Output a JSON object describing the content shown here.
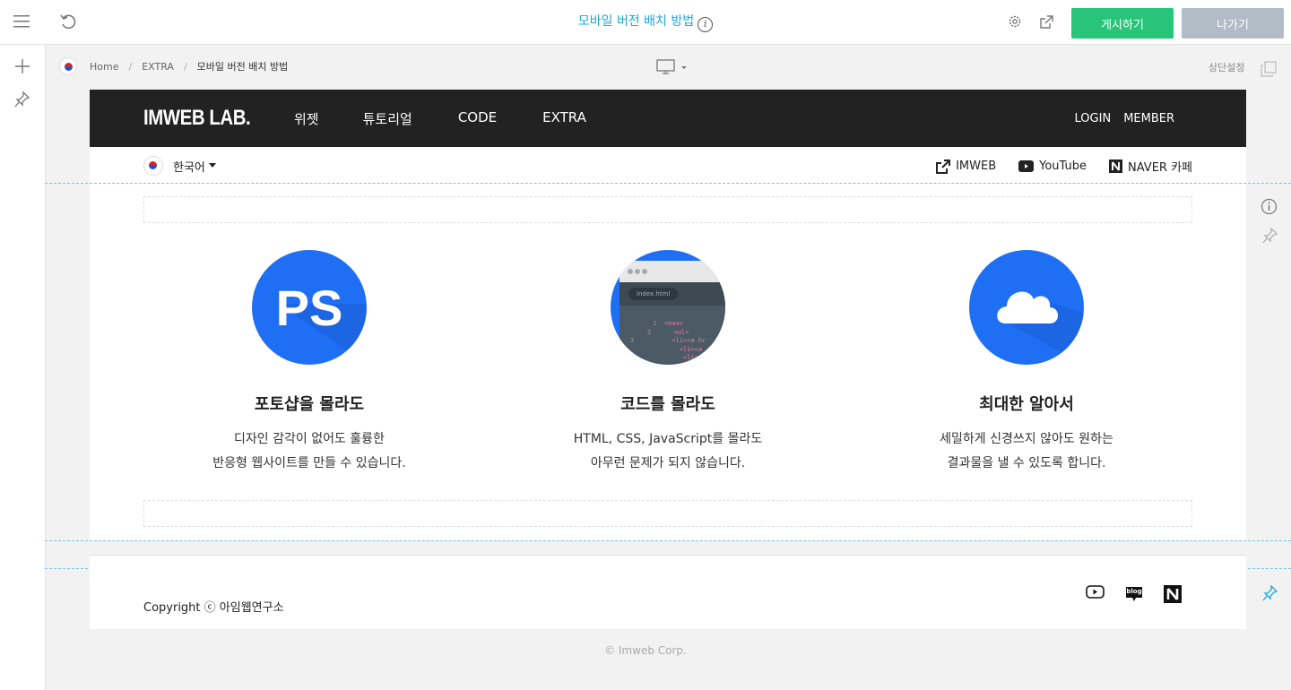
{
  "toolbar": {
    "page_title": "모바일 버전 배치 방법",
    "info_glyph": "i",
    "publish_label": "게시하기",
    "exit_label": "나가기"
  },
  "breadcrumb": {
    "items": [
      "Home",
      "EXTRA",
      "모바일 버전 배치 방법"
    ],
    "separator": "/"
  },
  "editor": {
    "top_setting_label": "상단설정"
  },
  "site": {
    "logo": "IMWEB LAB.",
    "nav": [
      "위젯",
      "튜토리얼",
      "CODE",
      "EXTRA"
    ],
    "login": "LOGIN",
    "member": "MEMBER",
    "language": "한국어",
    "links": [
      {
        "icon": "external-link-icon",
        "label": "IMWEB"
      },
      {
        "icon": "youtube-icon",
        "label": "YouTube"
      },
      {
        "icon": "naver-icon",
        "label": "NAVER 카페"
      }
    ]
  },
  "features": [
    {
      "icon": "photoshop-icon",
      "icon_text": "PS",
      "title": "포토샵을 몰라도",
      "line1": "디자인 감각이 없어도 훌륭한",
      "line2": "반응형 웹사이트를 만들 수 있습니다."
    },
    {
      "icon": "code-editor-icon",
      "icon_text": "index.html",
      "title": "코드를 몰라도",
      "line1": "HTML, CSS, JavaScript를 몰라도",
      "line2": "아무런 문제가 되지 않습니다."
    },
    {
      "icon": "cloud-icon",
      "icon_text": "",
      "title": "최대한 알아서",
      "line1": "세밀하게 신경쓰지 않아도 원하는",
      "line2": "결과물을 낼 수 있도록 합니다."
    }
  ],
  "code_lines": [
    {
      "num": "1",
      "text": "<nav>"
    },
    {
      "num": "2",
      "text": "<ul>"
    },
    {
      "num": "3",
      "text": "<li><a hr"
    },
    {
      "num": "",
      "text": "<li><a"
    },
    {
      "num": "",
      "text": "<li>"
    }
  ],
  "footer": {
    "copyright": "Copyright ⓒ 아임웹연구소",
    "social": [
      "youtube-icon",
      "blog-icon",
      "naver-icon"
    ],
    "blog_label": "blog",
    "corp": "© Imweb Corp."
  },
  "colors": {
    "accent": "#1fa7d9",
    "publish": "#27c47a",
    "exit": "#b1bcc6",
    "feature_blue": "#1f6ff5",
    "header_dark": "#222222"
  }
}
